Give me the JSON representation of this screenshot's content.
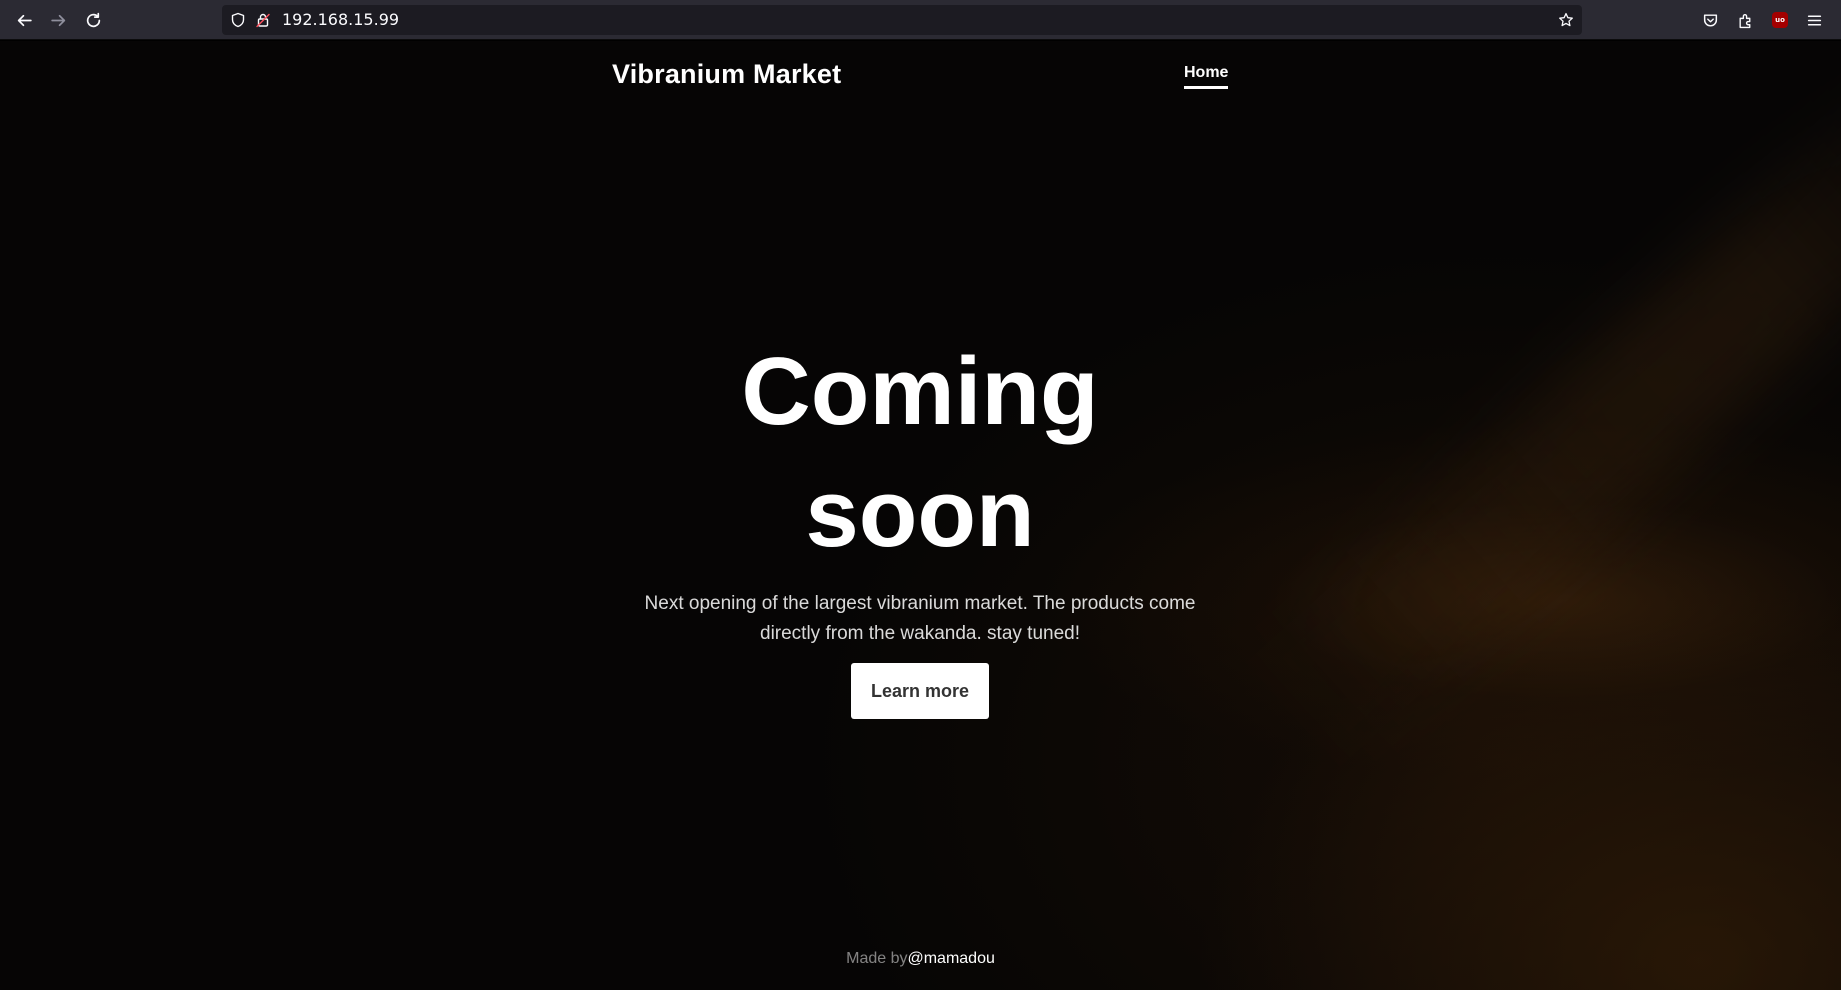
{
  "browser": {
    "url": "192.168.15.99",
    "ublock_badge": "uo"
  },
  "site": {
    "brand": "Vibranium Market",
    "nav": {
      "home_label": "Home"
    }
  },
  "hero": {
    "title_line1": "Coming",
    "title_line2": "soon",
    "lead": "Next opening of the largest vibranium market. The products come directly from the wakanda. stay tuned!",
    "button_label": "Learn more"
  },
  "footer": {
    "prefix": "Made by",
    "handle": "@mamadou"
  }
}
